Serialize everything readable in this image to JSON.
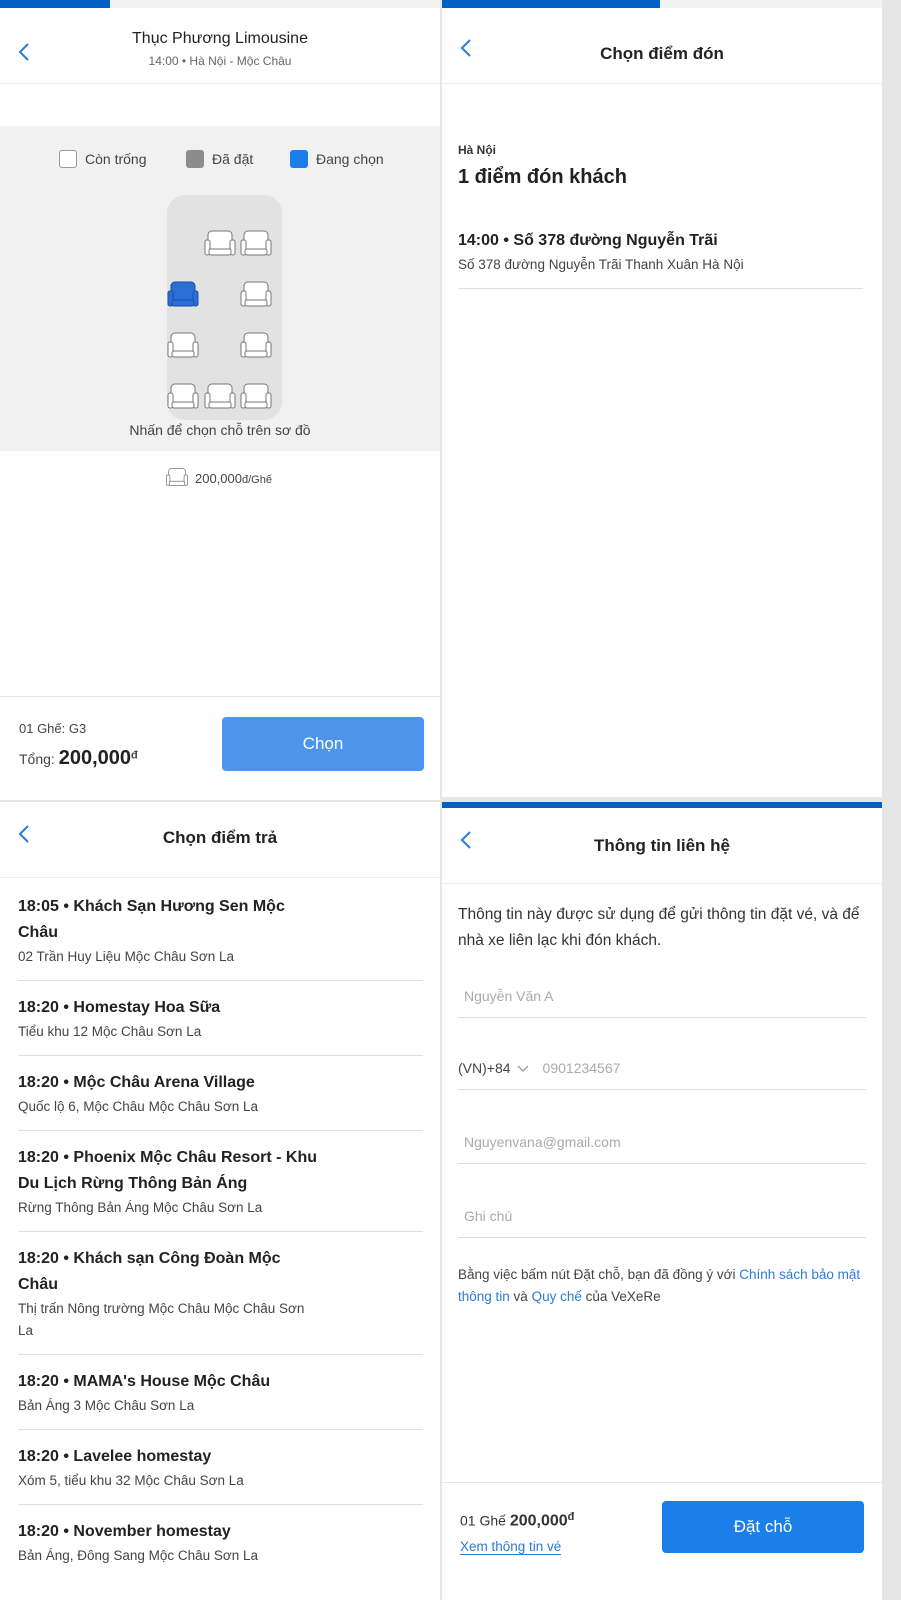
{
  "seat_screen": {
    "title": "Thục Phương Limousine",
    "subtitle": "14:00 • Hà Nội - Mộc Châu",
    "legend": [
      {
        "label": "Còn trống",
        "color": "#ffffff"
      },
      {
        "label": "Đã đặt",
        "color": "#8c8c8c"
      },
      {
        "label": "Đang chọn",
        "color": "#1a7fe8"
      }
    ],
    "hint": "Nhấn để chọn chỗ trên sơ đồ",
    "price": "200,000",
    "price_unit": "đ/Ghế",
    "seat_count": "01 Ghế: G3",
    "total_label": "Tổng: ",
    "total_value": "200,000",
    "currency": "đ",
    "choose_button": "Chọn",
    "colors": {
      "selected": "#2a6fd6",
      "available": "#ffffff",
      "accent": "#4d94ec"
    }
  },
  "pickup_screen": {
    "title": "Chọn điểm đón",
    "city": "Hà Nội",
    "count_title": "1 điểm đón khách",
    "items": [
      {
        "name": "14:00 • Số 378 đường Nguyễn Trãi",
        "address": "Số 378 đường Nguyễn Trãi Thanh Xuân Hà Nội"
      }
    ]
  },
  "dropoff_screen": {
    "title": "Chọn điểm trả",
    "items": [
      {
        "name": "18:05 • Khách Sạn Hương Sen Mộc Châu",
        "address": "02 Trần Huy Liệu Mộc Châu Sơn La"
      },
      {
        "name": "18:20 • Homestay Hoa Sữa",
        "address": "Tiểu khu 12 Mộc Châu Sơn La"
      },
      {
        "name": "18:20 • Mộc Châu Arena Village",
        "address": "Quốc lộ 6, Mộc Châu Mộc Châu Sơn La"
      },
      {
        "name": "18:20 • Phoenix Mộc Châu Resort - Khu Du Lịch Rừng Thông Bản Áng",
        "address": "Rừng Thông Bản Áng Mộc Châu Sơn La"
      },
      {
        "name": "18:20 • Khách sạn Công Đoàn Mộc Châu",
        "address": "Thị trấn Nông trường Mộc Châu Mộc Châu Sơn La"
      },
      {
        "name": "18:20 • MAMA's House Mộc Châu",
        "address": "Bản Áng 3 Mộc Châu Sơn La"
      },
      {
        "name": "18:20 • Lavelee homestay",
        "address": "Xóm 5, tiểu khu 32 Mộc Châu Sơn La"
      },
      {
        "name": "18:20 • November homestay",
        "address": "Bản Áng, Đông Sang Mộc Châu Sơn La"
      }
    ]
  },
  "contact_screen": {
    "title": "Thông tin liên hệ",
    "info": "Thông tin này được sử dụng để gửi thông tin đặt vé, và để nhà xe liên lạc khi đón khách.",
    "name_placeholder": "Nguyễn Văn A",
    "phone_code": "(VN)+84",
    "phone_placeholder": "0901234567",
    "email_placeholder": "Nguyenvana@gmail.com",
    "note_placeholder": "Ghi chú",
    "policy_prefix": "Bằng việc bấm nút Đặt chỗ, bạn đã đồng ý với ",
    "policy_link1": "Chính sách bảo mật thông tin",
    "policy_mid": " và ",
    "policy_link2": "Quy chế",
    "policy_suffix": " của VeXeRe",
    "seat_count": "01 Ghế ",
    "total_value": "200,000",
    "currency": "đ",
    "view_ticket": "Xem thông tin vé",
    "book_button": "Đặt chỗ"
  }
}
